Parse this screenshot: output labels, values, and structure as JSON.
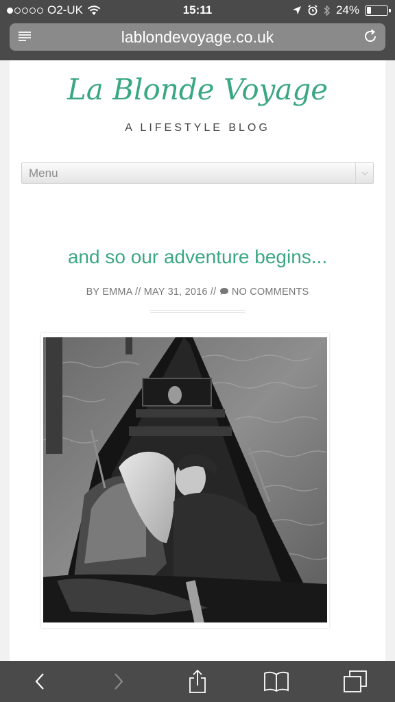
{
  "status_bar": {
    "carrier": "O2-UK",
    "time": "15:11",
    "battery_percent": "24%",
    "battery_level": 0.24,
    "signal_bars_filled": 1,
    "signal_bars_total": 5
  },
  "browser": {
    "url": "lablondevoyage.co.uk"
  },
  "site": {
    "logo_text": "La Blonde Voyage",
    "tagline": "A LIFESTYLE BLOG",
    "menu_label": "Menu"
  },
  "post": {
    "title": "and so our adventure begins...",
    "meta_author": "BY EMMA",
    "meta_sep": "//",
    "meta_date": "MAY 31, 2016",
    "meta_comments": "NO COMMENTS"
  },
  "colors": {
    "accent": "#3aa783",
    "browser_chrome": "#4a4a4a"
  },
  "icons": {
    "reader": "reader-icon",
    "reload": "reload-icon",
    "back": "back-arrow-icon",
    "forward": "forward-arrow-icon",
    "share": "share-icon",
    "bookmarks": "bookmarks-icon",
    "tabs": "tabs-icon"
  }
}
